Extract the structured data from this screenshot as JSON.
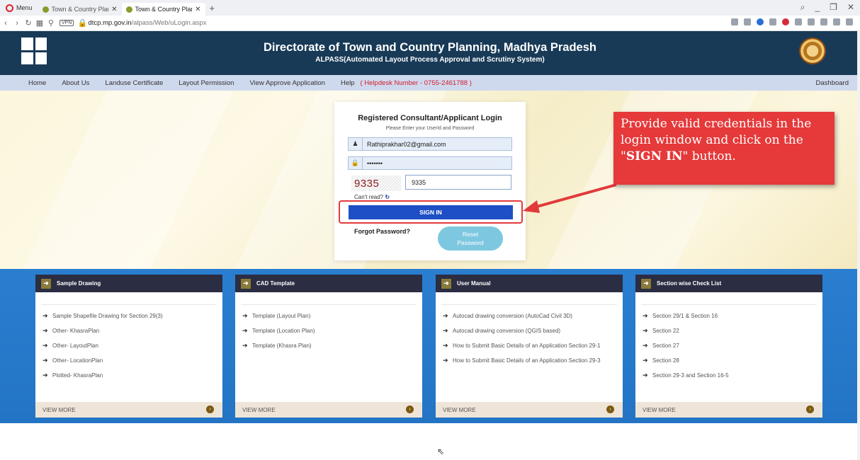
{
  "browser": {
    "menu_label": "Menu",
    "tabs": [
      {
        "label": "Town & Country Planning"
      },
      {
        "label": "Town & Country Planning"
      }
    ],
    "vpn_label": "VPN",
    "url_domain": "dtcp.mp.gov.in",
    "url_path": "/alpass/Web/uLogin.aspx"
  },
  "header": {
    "title": "Directorate of Town and Country Planning, Madhya Pradesh",
    "subtitle": "ALPASS(Automated Layout Process Approval and Scrutiny System)"
  },
  "nav": {
    "items": [
      {
        "label": "Home"
      },
      {
        "label": "About Us"
      },
      {
        "label": "Landuse Certificate"
      },
      {
        "label": "Layout Permission"
      },
      {
        "label": "View Approve Application"
      },
      {
        "label": "Help"
      }
    ],
    "helpdesk": "( Helpdesk Number - 0755-2461788 )",
    "dashboard": "Dashboard"
  },
  "login": {
    "title": "Registered Consultant/Applicant Login",
    "hint": "Please Enter your UserId and Password",
    "userid_value": "Rathiprakhar02@gmail.com",
    "password_value": "•••••••",
    "captcha_text": "9335",
    "captcha_input": "9335",
    "cant_read": "Can't read?",
    "signin_label": "SIGN IN",
    "forgot_label": "Forgot Password?",
    "reset_label_1": "Reset",
    "reset_label_2": "Password"
  },
  "callout": {
    "line1": "Provide valid credentials in the login window and click on the",
    "quote_open": "\"",
    "bold": "SIGN IN",
    "line_end": "\" button."
  },
  "cards": [
    {
      "title": "Sample Drawing",
      "items": [
        "Sample Shapefile Drawing for Section 29(3)",
        "Other- KhasraPlan",
        "Other- LayoutPlan",
        "Other- LocationPlan",
        "Plotted- KhasraPlan"
      ],
      "more": "VIEW MORE"
    },
    {
      "title": "CAD Template",
      "items": [
        "Template (Layout Plan)",
        "Template (Location Plan)",
        "Template (Khasra Plan)"
      ],
      "more": "VIEW MORE"
    },
    {
      "title": "User Manual",
      "items": [
        "Autocad drawing conversion (AutoCad Civil 3D)",
        "Autocad drawing conversion (QGIS based)",
        "How to Submit Basic Details of an Application Section 29-1",
        "How to Submit Basic Details of an Application Section 29-3"
      ],
      "more": "VIEW MORE"
    },
    {
      "title": "Section wise Check List",
      "items": [
        "Section 29/1 & Section 16",
        "Section 22",
        "Section 27",
        "Section 28",
        "Section 29-3 and Section 16-5"
      ],
      "more": "VIEW MORE"
    }
  ],
  "icons": {
    "arrow": "arrow-right-icon",
    "chevron": "chevron-circle-icon",
    "user": "user-icon",
    "lock": "lock-icon",
    "refresh": "refresh-icon"
  },
  "colors": {
    "header_bg": "#183a57",
    "nav_bg": "#cfd9ee",
    "signin_bg": "#1f4fc4",
    "callout_bg": "#e5393a",
    "band_bg": "#2a7ed0"
  }
}
